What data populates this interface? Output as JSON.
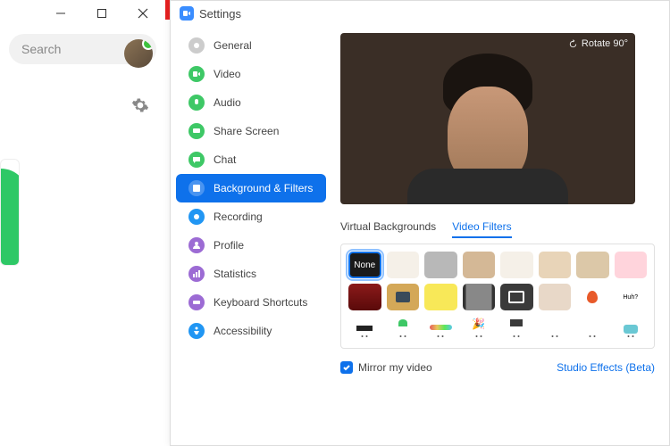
{
  "bg_window": {
    "search_placeholder": "Search"
  },
  "settings": {
    "title": "Settings",
    "rotate_label": "Rotate 90°",
    "sidebar": [
      {
        "key": "general",
        "label": "General"
      },
      {
        "key": "video",
        "label": "Video"
      },
      {
        "key": "audio",
        "label": "Audio"
      },
      {
        "key": "share",
        "label": "Share Screen"
      },
      {
        "key": "chat",
        "label": "Chat"
      },
      {
        "key": "bgfilters",
        "label": "Background & Filters"
      },
      {
        "key": "recording",
        "label": "Recording"
      },
      {
        "key": "profile",
        "label": "Profile"
      },
      {
        "key": "statistics",
        "label": "Statistics"
      },
      {
        "key": "kbshortcuts",
        "label": "Keyboard Shortcuts"
      },
      {
        "key": "accessibility",
        "label": "Accessibility"
      }
    ],
    "tabs": {
      "virtual_bg": "Virtual Backgrounds",
      "video_filters": "Video Filters"
    },
    "filters": {
      "none_label": "None",
      "bubble_text": "Huh?"
    },
    "mirror_label": "Mirror my video",
    "studio_label": "Studio Effects (Beta)"
  }
}
